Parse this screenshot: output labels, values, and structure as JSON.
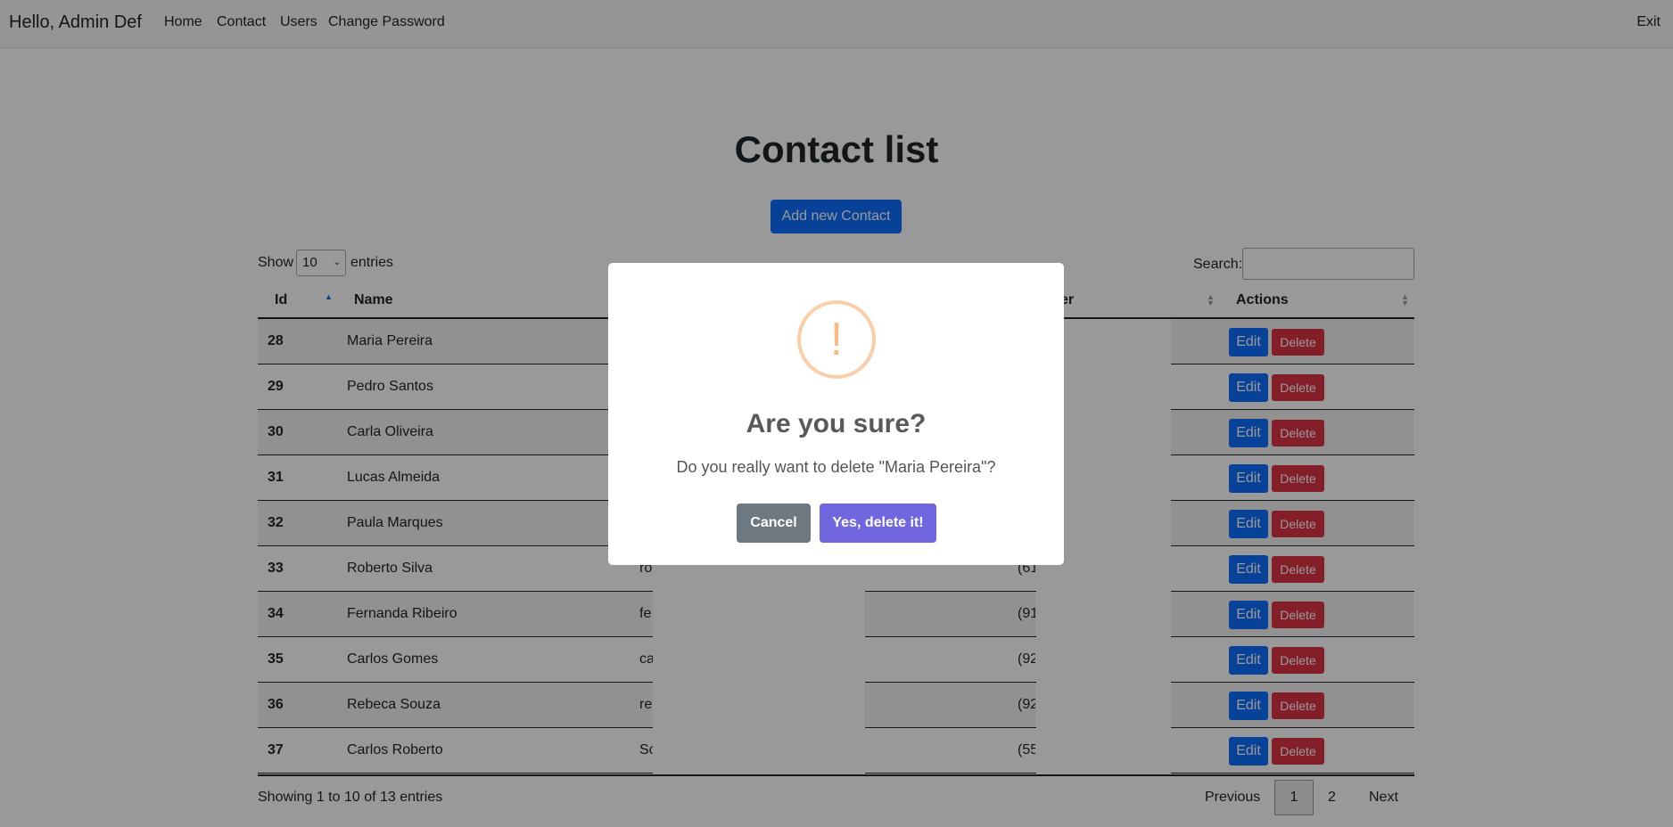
{
  "navbar": {
    "brand": "Hello, Admin Def",
    "links": [
      "Home",
      "Contact",
      "Users",
      "Change Password"
    ],
    "exit": "Exit"
  },
  "page": {
    "title": "Contact list",
    "add_button": "Add new Contact"
  },
  "controls": {
    "show_label": "Show",
    "entries_value": "10",
    "entries_label": "entries",
    "search_label": "Search:"
  },
  "table": {
    "columns": [
      "Id",
      "Name",
      "er",
      "Actions"
    ],
    "rows": [
      {
        "id": "28",
        "name": "Maria Pereira",
        "email": "",
        "phone": ""
      },
      {
        "id": "29",
        "name": "Pedro Santos",
        "email": "",
        "phone": ""
      },
      {
        "id": "30",
        "name": "Carla Oliveira",
        "email": "",
        "phone": ""
      },
      {
        "id": "31",
        "name": "Lucas Almeida",
        "email": "",
        "phone": ""
      },
      {
        "id": "32",
        "name": "Paula Marques",
        "email": "",
        "phone": ""
      },
      {
        "id": "33",
        "name": "Roberto Silva",
        "email": "ro",
        "phone": "(61"
      },
      {
        "id": "34",
        "name": "Fernanda Ribeiro",
        "email": "fe",
        "phone": "(91"
      },
      {
        "id": "35",
        "name": "Carlos Gomes",
        "email": "ca",
        "phone": "(92"
      },
      {
        "id": "36",
        "name": "Rebeca Souza",
        "email": "re",
        "phone": "(92"
      },
      {
        "id": "37",
        "name": "Carlos Roberto",
        "email": "Sc",
        "phone": "(55"
      }
    ],
    "edit_label": "Edit",
    "delete_label": "Delete"
  },
  "footer": {
    "info": "Showing 1 to 10 of 13 entries",
    "previous": "Previous",
    "page1": "1",
    "page2": "2",
    "next": "Next"
  },
  "modal": {
    "icon": "!",
    "title": "Are you sure?",
    "text": "Do you really want to delete \"Maria Pereira\"?",
    "cancel": "Cancel",
    "confirm": "Yes, delete it!"
  },
  "colors": {
    "primary": "#0d6efd",
    "danger": "#dc3545",
    "confirm": "#7066e0",
    "cancel": "#6e7881",
    "warning": "#f8bb86"
  }
}
